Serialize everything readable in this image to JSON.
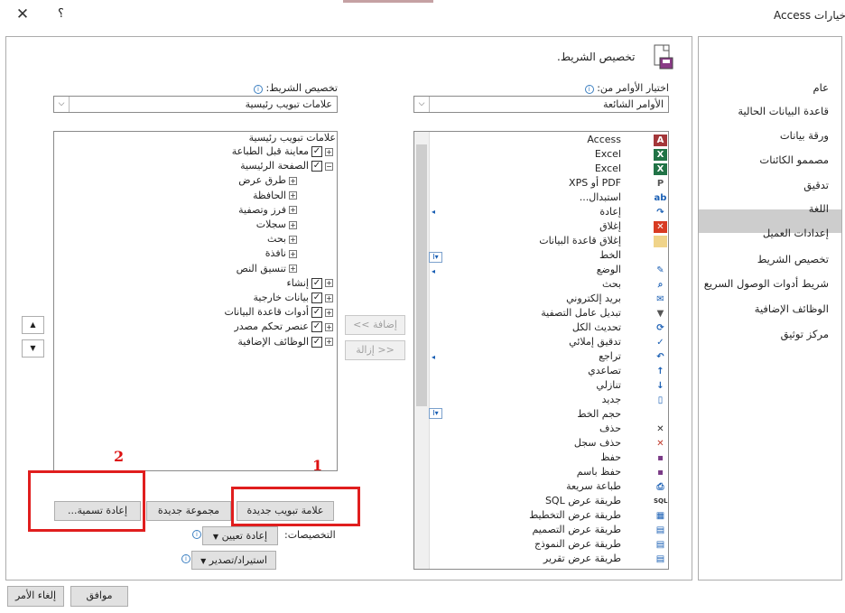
{
  "window": {
    "title": "خيارات Access",
    "close_glyph": "✕",
    "help_glyph": "؟"
  },
  "nav": {
    "items": [
      "عام",
      "قاعدة البيانات الحالية",
      "ورقة بيانات",
      "مصممو الكائنات",
      "تدقيق",
      "اللغة",
      "إعدادات العميل",
      "تخصيص الشريط",
      "شريط أدوات الوصول السريع",
      "الوظائف الإضافية",
      "مركز توثيق"
    ],
    "selected": "تخصيص الشريط"
  },
  "header": {
    "text": "تخصيص الشريط."
  },
  "choose": {
    "label": "اختيار الأوامر من:",
    "value": "الأوامر الشائعة"
  },
  "customize": {
    "label": "تخصيص الشريط:",
    "value": "علامات تبويب رئيسية"
  },
  "commands": [
    {
      "label": "Access",
      "icon": "access-icon"
    },
    {
      "label": "Excel",
      "icon": "excel-icon"
    },
    {
      "label": "Excel",
      "icon": "excel-icon"
    },
    {
      "label": "PDF أو XPS",
      "icon": "pdf-icon"
    },
    {
      "label": "استبدال...",
      "icon": "replace-icon"
    },
    {
      "label": "إعادة",
      "icon": "redo-icon"
    },
    {
      "label": "إغلاق",
      "icon": "close-db-icon"
    },
    {
      "label": "إغلاق قاعدة البيانات",
      "icon": "folder-icon"
    },
    {
      "label": "الخط",
      "icon": ""
    },
    {
      "label": "الوضع",
      "icon": "view-icon"
    },
    {
      "label": "بحث",
      "icon": "find-icon"
    },
    {
      "label": "بريد إلكتروني",
      "icon": "attach-icon"
    },
    {
      "label": "تبديل عامل التصفية",
      "icon": "filter-icon"
    },
    {
      "label": "تحديث الكل",
      "icon": "refresh-icon"
    },
    {
      "label": "تدقيق إملائي",
      "icon": "spelling-icon"
    },
    {
      "label": "تراجع",
      "icon": "undo-icon"
    },
    {
      "label": "تصاعدي",
      "icon": "sort-asc-icon"
    },
    {
      "label": "تنازلي",
      "icon": "sort-desc-icon"
    },
    {
      "label": "جديد",
      "icon": "new-doc-icon"
    },
    {
      "label": "حجم الخط",
      "icon": ""
    },
    {
      "label": "حذف",
      "icon": "delete-icon"
    },
    {
      "label": "حذف سجل",
      "icon": "delete-record-icon"
    },
    {
      "label": "حفظ",
      "icon": "save-icon"
    },
    {
      "label": "حفظ باسم",
      "icon": "save-as-icon"
    },
    {
      "label": "طباعة سريعة",
      "icon": "quick-print-icon"
    },
    {
      "label": "طريقة عرض SQL",
      "icon": "sql-icon"
    },
    {
      "label": "طريقة عرض التخطيط",
      "icon": "layout-view-icon"
    },
    {
      "label": "طريقة عرض التصميم",
      "icon": "design-view-icon"
    },
    {
      "label": "طريقة عرض النموذج",
      "icon": "form-view-icon"
    },
    {
      "label": "طريقة عرض تقرير",
      "icon": "report-view-icon"
    }
  ],
  "icon_glyphs": {
    "Access": "A",
    "Excel": "X",
    "PDF أو XPS": "P",
    "استبدال...": "ab",
    "إعادة": "↷",
    "إغلاق": "✕",
    "إغلاق قاعدة البيانات": "▭",
    "الوضع": "✎",
    "بحث": "⌕",
    "بريد إلكتروني": "✉",
    "تبديل عامل التصفية": "▼",
    "تحديث الكل": "⟳",
    "تدقيق إملائي": "✓",
    "تراجع": "↶",
    "تصاعدي": "↑",
    "تنازلي": "↓",
    "جديد": "▯",
    "حذف": "✕",
    "حذف سجل": "✕",
    "حفظ": "▪",
    "حفظ باسم": "▪",
    "طباعة سريعة": "⎙",
    "طريقة عرض SQL": "SQL",
    "طريقة عرض التخطيط": "▦",
    "طريقة عرض التصميم": "▤",
    "طريقة عرض النموذج": "▤",
    "طريقة عرض تقرير": "▤"
  },
  "tree": {
    "header": "علامات تبويب رئيسية",
    "items": [
      {
        "label": "معاينة قبل الطباعة",
        "checked": true,
        "level": 0,
        "expander": "+"
      },
      {
        "label": "الصفحة الرئيسية",
        "checked": true,
        "level": 0,
        "expander": "−",
        "selected": true
      },
      {
        "label": "طرق عرض",
        "level": 1,
        "expander": "+"
      },
      {
        "label": "الحافظة",
        "level": 1,
        "expander": "+"
      },
      {
        "label": "فرز وتصفية",
        "level": 1,
        "expander": "+"
      },
      {
        "label": "سجلات",
        "level": 1,
        "expander": "+"
      },
      {
        "label": "بحث",
        "level": 1,
        "expander": "+"
      },
      {
        "label": "نافذة",
        "level": 1,
        "expander": "+"
      },
      {
        "label": "تنسيق النص",
        "level": 1,
        "expander": "+"
      },
      {
        "label": "إنشاء",
        "checked": true,
        "level": 0,
        "expander": "+"
      },
      {
        "label": "بيانات خارجية",
        "checked": true,
        "level": 0,
        "expander": "+"
      },
      {
        "label": "أدوات قاعدة البيانات",
        "checked": true,
        "level": 0,
        "expander": "+"
      },
      {
        "label": "عنصر تحكم مصدر",
        "checked": true,
        "level": 0,
        "expander": "+"
      },
      {
        "label": "الوظائف الإضافية",
        "checked": true,
        "level": 0,
        "expander": "+"
      }
    ]
  },
  "buttons": {
    "add": "إضافة >>",
    "remove": "<< إزالة",
    "new_tab": "علامة تبويب جديدة",
    "new_group": "مجموعة جديدة",
    "rename": "إعادة تسمية...",
    "ok": "موافق",
    "cancel": "إلغاء الأمر"
  },
  "customizations": {
    "label": "التخصيصات:",
    "reset": "إعادة تعيين",
    "import_export": "استيراد/تصدير"
  },
  "annotations": {
    "one": "1",
    "two": "2"
  },
  "move": {
    "up": "▲",
    "down": "▼"
  },
  "check_glyph": "✓",
  "info_glyph": "i",
  "combo_arrow": "⌵",
  "colors": {
    "selection": "#cdcdcd",
    "annotation": "#e01e1e",
    "access": "#a4373a",
    "excel": "#217346",
    "link": "#1a5fb4"
  }
}
